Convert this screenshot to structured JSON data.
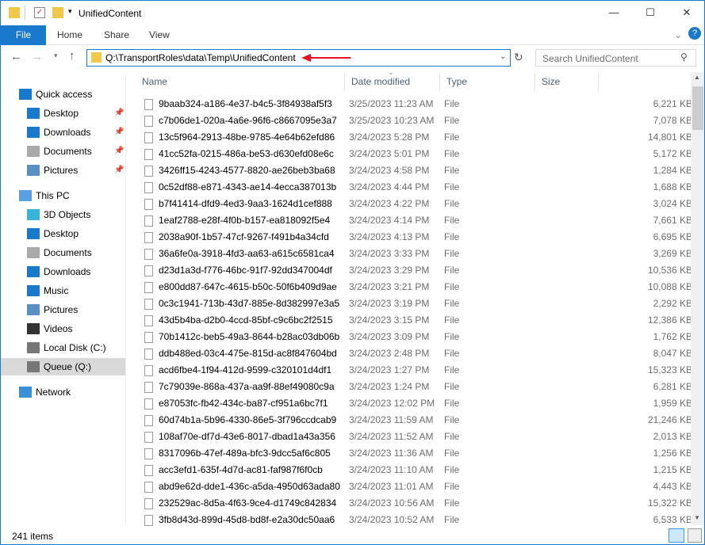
{
  "window": {
    "title": "UnifiedContent",
    "minimize": "—",
    "maximize": "☐",
    "close": "✕"
  },
  "ribbon": {
    "tabs": [
      "File",
      "Home",
      "Share",
      "View"
    ]
  },
  "address": {
    "path": "Q:\\TransportRoles\\data\\Temp\\UnifiedContent",
    "search_placeholder": "Search UnifiedContent"
  },
  "columns": [
    "Name",
    "Date modified",
    "Type",
    "Size"
  ],
  "nav": [
    {
      "label": "Quick access",
      "icon": "star-icon",
      "pinned": false
    },
    {
      "label": "Desktop",
      "icon": "desktop-icon",
      "pinned": true
    },
    {
      "label": "Downloads",
      "icon": "downloads-icon",
      "pinned": true
    },
    {
      "label": "Documents",
      "icon": "documents-icon",
      "pinned": true
    },
    {
      "label": "Pictures",
      "icon": "pictures-icon",
      "pinned": true
    },
    {
      "label": "This PC",
      "icon": "computer-icon",
      "pinned": false
    },
    {
      "label": "3D Objects",
      "icon": "3d-objects-icon",
      "pinned": false
    },
    {
      "label": "Desktop",
      "icon": "desktop-icon",
      "pinned": false
    },
    {
      "label": "Documents",
      "icon": "documents-icon",
      "pinned": false
    },
    {
      "label": "Downloads",
      "icon": "downloads-icon",
      "pinned": false
    },
    {
      "label": "Music",
      "icon": "music-icon",
      "pinned": false
    },
    {
      "label": "Pictures",
      "icon": "pictures-icon",
      "pinned": false
    },
    {
      "label": "Videos",
      "icon": "videos-icon",
      "pinned": false
    },
    {
      "label": "Local Disk (C:)",
      "icon": "drive-icon",
      "pinned": false
    },
    {
      "label": "Queue (Q:)",
      "icon": "drive-icon",
      "pinned": false,
      "selected": true
    },
    {
      "label": "Network",
      "icon": "network-icon",
      "pinned": false
    }
  ],
  "files": [
    [
      "9baab324-a186-4e37-b4c5-3f84938af5f3",
      "3/25/2023 11:23 AM",
      "File",
      "6,221 KB"
    ],
    [
      "c7b06de1-020a-4a6e-96f6-c8667095e3a7",
      "3/25/2023 10:23 AM",
      "File",
      "7,078 KB"
    ],
    [
      "13c5f964-2913-48be-9785-4e64b62efd86",
      "3/24/2023 5:28 PM",
      "File",
      "14,801 KB"
    ],
    [
      "41cc52fa-0215-486a-be53-d630efd08e6c",
      "3/24/2023 5:01 PM",
      "File",
      "5,172 KB"
    ],
    [
      "3426ff15-4243-4577-8820-ae26beb3ba68",
      "3/24/2023 4:58 PM",
      "File",
      "1,284 KB"
    ],
    [
      "0c52df88-e871-4343-ae14-4ecca387013b",
      "3/24/2023 4:44 PM",
      "File",
      "1,688 KB"
    ],
    [
      "b7f41414-dfd9-4ed3-9aa3-1624d1cef888",
      "3/24/2023 4:22 PM",
      "File",
      "3,024 KB"
    ],
    [
      "1eaf2788-e28f-4f0b-b157-ea818092f5e4",
      "3/24/2023 4:14 PM",
      "File",
      "7,661 KB"
    ],
    [
      "2038a90f-1b57-47cf-9267-f491b4a34cfd",
      "3/24/2023 4:13 PM",
      "File",
      "6,695 KB"
    ],
    [
      "36a6fe0a-3918-4fd3-aa63-a615c6581ca4",
      "3/24/2023 3:33 PM",
      "File",
      "3,269 KB"
    ],
    [
      "d23d1a3d-f776-46bc-91f7-92dd347004df",
      "3/24/2023 3:29 PM",
      "File",
      "10,536 KB"
    ],
    [
      "e800dd87-647c-4615-b50c-50f6b409d9ae",
      "3/24/2023 3:21 PM",
      "File",
      "10,088 KB"
    ],
    [
      "0c3c1941-713b-43d7-885e-8d382997e3a5",
      "3/24/2023 3:19 PM",
      "File",
      "2,292 KB"
    ],
    [
      "43d5b4ba-d2b0-4ccd-85bf-c9c6bc2f2515",
      "3/24/2023 3:15 PM",
      "File",
      "12,386 KB"
    ],
    [
      "70b1412c-beb5-49a3-8644-b28ac03db06b",
      "3/24/2023 3:09 PM",
      "File",
      "1,762 KB"
    ],
    [
      "ddb488ed-03c4-475e-815d-ac8f847604bd",
      "3/24/2023 2:48 PM",
      "File",
      "8,047 KB"
    ],
    [
      "acd6fbe4-1f94-412d-9599-c320101d4df1",
      "3/24/2023 1:27 PM",
      "File",
      "15,323 KB"
    ],
    [
      "7c79039e-868a-437a-aa9f-88ef49080c9a",
      "3/24/2023 1:24 PM",
      "File",
      "6,281 KB"
    ],
    [
      "e87053fc-fb42-434c-ba87-cf951a6bc7f1",
      "3/24/2023 12:02 PM",
      "File",
      "1,959 KB"
    ],
    [
      "60d74b1a-5b96-4330-86e5-3f796ccdcab9",
      "3/24/2023 11:59 AM",
      "File",
      "21,246 KB"
    ],
    [
      "108af70e-df7d-43e6-8017-dbad1a43a356",
      "3/24/2023 11:52 AM",
      "File",
      "2,013 KB"
    ],
    [
      "8317096b-47ef-489a-bfc3-9dcc5af6c805",
      "3/24/2023 11:36 AM",
      "File",
      "1,256 KB"
    ],
    [
      "acc3efd1-635f-4d7d-ac81-faf987f6f0cb",
      "3/24/2023 11:10 AM",
      "File",
      "1,215 KB"
    ],
    [
      "abd9e62d-dde1-436c-a5da-4950d63ada80",
      "3/24/2023 11:01 AM",
      "File",
      "4,443 KB"
    ],
    [
      "232529ac-8d5a-4f63-9ce4-d1749c842834",
      "3/24/2023 10:56 AM",
      "File",
      "15,322 KB"
    ],
    [
      "3fb8d43d-899d-45d8-bd8f-e2a30dc50aa6",
      "3/24/2023 10:52 AM",
      "File",
      "6,533 KB"
    ]
  ],
  "status": {
    "item_count": "241 items"
  },
  "colors": {
    "accent": "#1979ca",
    "annotation_arrow": "#e81123"
  }
}
